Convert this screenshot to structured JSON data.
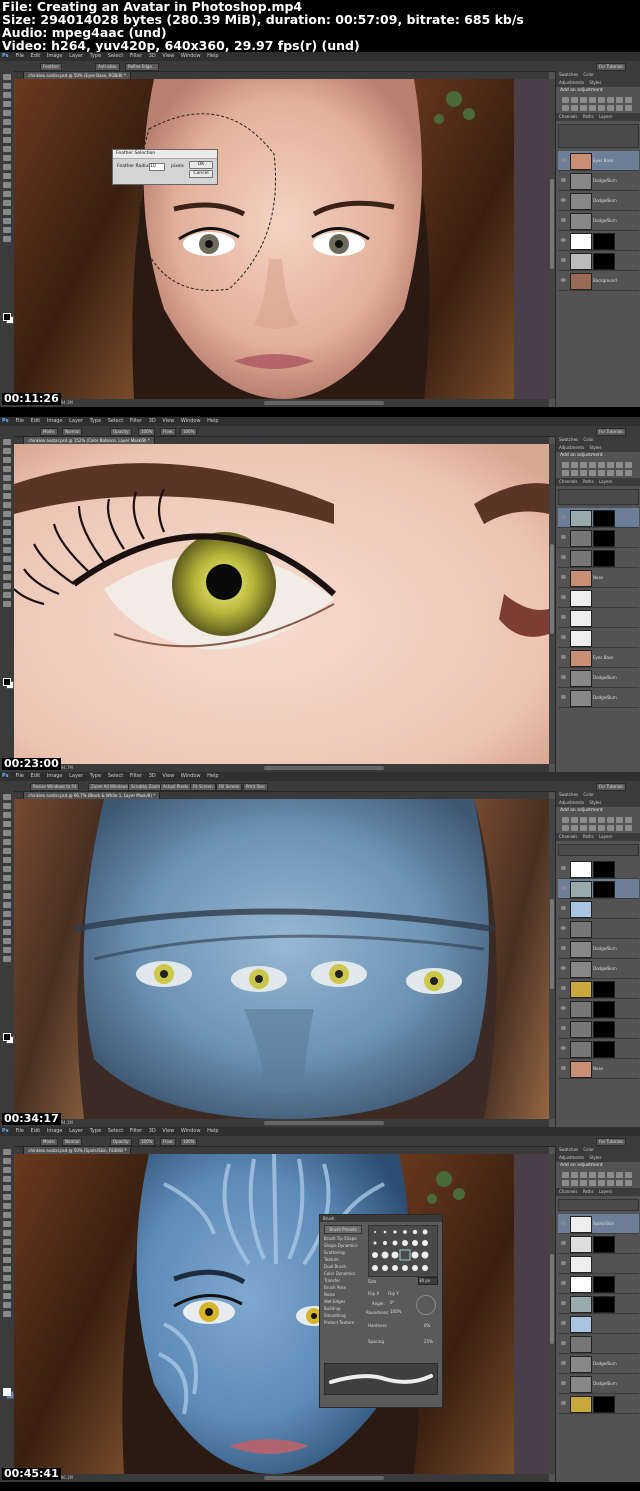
{
  "header": {
    "line1": "File: Creating an Avatar in Photoshop.mp4",
    "line2": "Size: 294014028 bytes (280.39 MiB), duration: 00:57:09, bitrate: 685 kb/s",
    "line3": "Audio: mpeg4aac (und)",
    "line4": "Video: h264, yuv420p, 640x360, 29.97 fps(r) (und)"
  },
  "menu": [
    "File",
    "Edit",
    "Image",
    "Layer",
    "Type",
    "Select",
    "Filter",
    "3D",
    "View",
    "Window",
    "Help"
  ],
  "app_badge": "Ps",
  "frames": [
    {
      "timestamp": "00:11:26",
      "tab": "chinkiea avatar.psd @ 50% (Eyes Base, RGB/8) *",
      "status": "Doc: 11.4M/194.3M",
      "panel_title": "Add an adjustment",
      "panel_tabs": [
        "Swatches",
        "Color",
        "Adjustments",
        "Styles"
      ],
      "layer_tabs": [
        "Channels",
        "Paths",
        "Layers"
      ],
      "layers": [
        "Eyes Base",
        "Dodge/Burn",
        "Dodge/Burn",
        "Dodge/Burn",
        "",
        "",
        "Background"
      ],
      "dialog": {
        "title": "Feather Selection",
        "label": "Feather Radius:",
        "value": "10",
        "unit": "pixels",
        "ok": "OK",
        "cancel": "Cancel"
      },
      "options": [
        "Feather:",
        "Anti-alias",
        "Refine Edge..."
      ],
      "workspace": "For Tutorials"
    },
    {
      "timestamp": "00:23:00",
      "tab": "chinkiea avatar.psd @ 152% (Color Balance, Layer Mask/8) *",
      "status": "Doc: 11.4M/194.7M",
      "panel_title": "Add an adjustment",
      "panel_tabs": [
        "Swatches",
        "Color",
        "Adjustments",
        "Styles"
      ],
      "layer_tabs": [
        "Channels",
        "Paths",
        "Layers"
      ],
      "layers": [
        "",
        "",
        "",
        "Nose",
        "",
        "",
        "",
        "Eyes Base",
        "Dodge/Burn",
        "Dodge/Burn"
      ],
      "options": [
        "Mode:",
        "Normal",
        "Opacity:",
        "100%",
        "Flow:",
        "100%"
      ],
      "workspace": "For Tutorials"
    },
    {
      "timestamp": "00:34:17",
      "tab": "chinkiea avatar.psd @ 66.7% (Black & White 1, Layer Mask/8) *",
      "status": "Doc: 11.4M/194.1M",
      "panel_title": "Add an adjustment",
      "panel_tabs": [
        "Swatches",
        "Color",
        "Adjustments",
        "Styles"
      ],
      "layer_tabs": [
        "Channels",
        "Paths",
        "Layers"
      ],
      "layers": [
        "",
        "",
        "",
        "",
        "Dodge/Burn",
        "Dodge/Burn",
        "",
        "",
        "",
        "",
        "Nose",
        ""
      ],
      "options": [
        "Resize Windows to Fit",
        "Zoom All Windows",
        "Scrubby Zoom",
        "Actual Pixels",
        "Fit Screen",
        "Fill Screen",
        "Print Size"
      ],
      "workspace": "For Tutorials"
    },
    {
      "timestamp": "00:45:41",
      "tab": "chinkiea avatar.psd @ 50% (Spots/Skin, RGB/8) *",
      "status": "Doc: 11.4M/196.1M",
      "panel_title": "Add an adjustment",
      "panel_tabs": [
        "Swatches",
        "Color",
        "Adjustments",
        "Styles"
      ],
      "layer_tabs": [
        "Channels",
        "Paths",
        "Layers"
      ],
      "layers": [
        "Spots/Skin",
        "",
        "",
        "",
        "",
        "",
        "",
        "Dodge/Burn",
        "Dodge/Burn",
        "",
        ""
      ],
      "options": [
        "Mode:",
        "Normal",
        "Opacity:",
        "100%",
        "Flow:",
        "100%"
      ],
      "workspace": "For Tutorials",
      "brush_panel": {
        "title": "Brush",
        "presets_btn": "Brush Presets",
        "items": [
          "Brush Tip Shape",
          "Shape Dynamics",
          "Scattering",
          "Texture",
          "Dual Brush",
          "Color Dynamics",
          "Transfer",
          "Brush Pose",
          "Noise",
          "Wet Edges",
          "Build-up",
          "Smoothing",
          "Protect Texture"
        ],
        "size_label": "Size",
        "size_value": "30 px",
        "flip_x": "Flip X",
        "flip_y": "Flip Y",
        "angle_label": "Angle:",
        "angle_value": "0°",
        "roundness_label": "Roundness:",
        "roundness_value": "100%",
        "hardness_label": "Hardness",
        "hardness_value": "0%",
        "spacing_label": "Spacing",
        "spacing_value": "25%"
      }
    }
  ]
}
